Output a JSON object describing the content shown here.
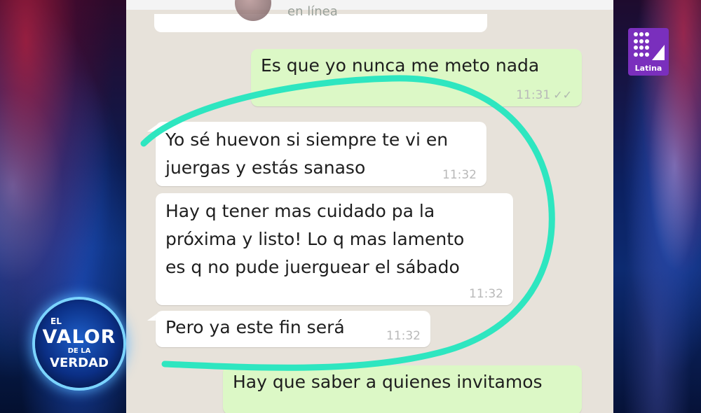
{
  "chat": {
    "status": "en línea",
    "messages": [
      {
        "dir": "out",
        "text": "Es que yo nunca me meto nada",
        "time": "11:31",
        "ticks": "✓✓"
      },
      {
        "dir": "in",
        "line1": "Yo sé huevon si siempre te vi en",
        "line2": "juergas y estás sanaso",
        "time": "11:32"
      },
      {
        "dir": "in",
        "line1": "Hay q tener mas cuidado pa la",
        "line2": "próxima y listo! Lo q mas lamento",
        "line3": "es q no pude juerguear el sábado",
        "time": "11:32"
      },
      {
        "dir": "in",
        "text": "Pero ya este fin será",
        "time": "11:32"
      },
      {
        "dir": "out",
        "text": "Hay que saber a quienes invitamos"
      }
    ]
  },
  "annotation": {
    "color": "#2ee6c0"
  },
  "logos": {
    "channel": "Latina",
    "show_top": "EL",
    "show_main": "VALOR",
    "show_de": "DE LA",
    "show_sub": "VERDAD"
  }
}
